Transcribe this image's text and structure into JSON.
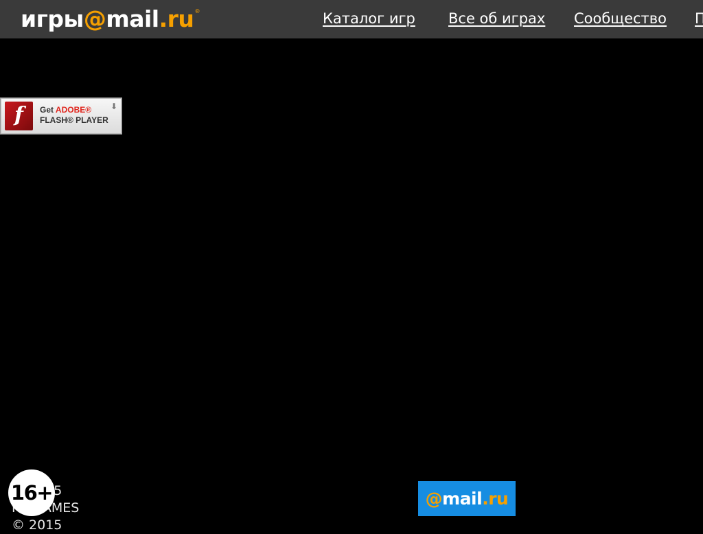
{
  "header": {
    "logo": {
      "part1": "игры",
      "at": "@",
      "part2": "mail",
      "dot": ".",
      "part3": "ru",
      "reg": "®"
    },
    "nav": [
      {
        "label": "Каталог игр"
      },
      {
        "label": "Все об играх"
      },
      {
        "label": "Сообщество"
      },
      {
        "label": "П"
      }
    ]
  },
  "flash_badge": {
    "icon_glyph": "f",
    "get": "Get",
    "adobe": "ADOBE®",
    "product": "FLASH® PLAYER",
    "arrow": "⬇"
  },
  "footer": {
    "lines": [
      "© 2015",
      "MY.GAMES",
      "© 2015"
    ],
    "age_rating": "16+",
    "mailru_logo": {
      "at": "@",
      "mail": "mail",
      "dot": ".",
      "ru": "ru"
    }
  },
  "colors": {
    "topbar": "#3a3a3a",
    "background": "#000000",
    "orange": "#f6a000",
    "mailru_blue": "#168de2"
  }
}
